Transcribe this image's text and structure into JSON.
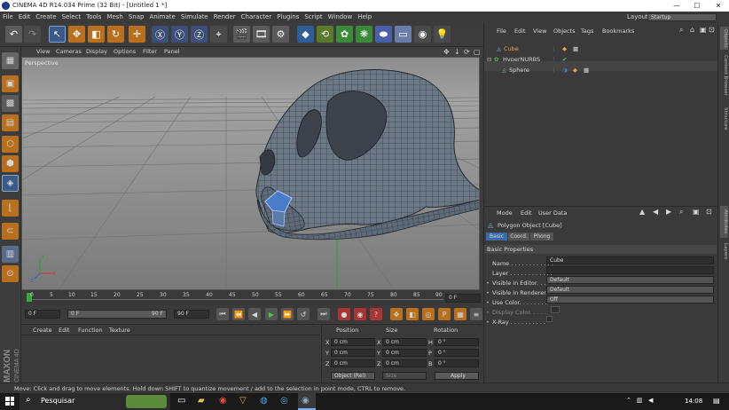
{
  "window": {
    "title": "CINEMA 4D R14.034 Prime (32 Bit) - [Untitled 1 *]",
    "min": "—",
    "max": "☐",
    "close": "✕"
  },
  "menu": [
    "File",
    "Edit",
    "Create",
    "Select",
    "Tools",
    "Mesh",
    "Snap",
    "Animate",
    "Simulate",
    "Render",
    "Character",
    "Plugins",
    "Script",
    "Window",
    "Help"
  ],
  "layout": {
    "label": "Layout:",
    "value": "Startup"
  },
  "viewport": {
    "menu": [
      "View",
      "Cameras",
      "Display",
      "Options",
      "Filter",
      "Panel"
    ],
    "label": "Perspective"
  },
  "timeline": {
    "ticks": [
      "0",
      "5",
      "10",
      "15",
      "20",
      "25",
      "30",
      "35",
      "40",
      "45",
      "50",
      "55",
      "60",
      "65",
      "70",
      "75",
      "80",
      "85",
      "90"
    ],
    "current": "0 F"
  },
  "controls": {
    "start": "0 F",
    "range_start": "0 F",
    "range_end": "90 F",
    "end": "90 F"
  },
  "material": {
    "menu": [
      "Create",
      "Edit",
      "Function",
      "Texture"
    ]
  },
  "coords": {
    "headers": [
      "Position",
      "Size",
      "Rotation"
    ],
    "rows": [
      {
        "axis": "X",
        "pos": "0 cm",
        "size_axis": "X",
        "size": "0 cm",
        "rot_axis": "H",
        "rot": "0 °"
      },
      {
        "axis": "Y",
        "pos": "0 cm",
        "size_axis": "Y",
        "size": "0 cm",
        "rot_axis": "P",
        "rot": "0 °"
      },
      {
        "axis": "Z",
        "pos": "0 cm",
        "size_axis": "Z",
        "size": "0 cm",
        "rot_axis": "B",
        "rot": "0 °"
      }
    ],
    "mode": "Object (Rel)",
    "size_mode": "Size",
    "apply": "Apply"
  },
  "objects": {
    "menu": [
      "File",
      "Edit",
      "View",
      "Objects",
      "Tags",
      "Bookmarks"
    ],
    "items": [
      {
        "name": "Cube",
        "color": "#e8a544"
      },
      {
        "name": "HyperNURBS",
        "color": "#d0d0d0"
      },
      {
        "name": "Sphere",
        "color": "#d0d0d0"
      }
    ]
  },
  "attributes": {
    "menu": [
      "Mode",
      "Edit",
      "User Data"
    ],
    "object_title": "Polygon Object [Cube]",
    "tabs": [
      "Basic",
      "Coord.",
      "Phong"
    ],
    "section": "Basic Properties",
    "props": [
      {
        "label": "Name . . . . . . . . . . . .",
        "value": "Cube"
      },
      {
        "label": "Layer . . . . . . . . . . . .",
        "value": ""
      },
      {
        "label": "Visible in Editor. . .",
        "value": "Default"
      },
      {
        "label": "Visible in Renderer",
        "value": "Default"
      },
      {
        "label": "Use Color. . . . . . . .",
        "value": "Off"
      },
      {
        "label": "Display Color. . . . .",
        "value": ""
      },
      {
        "label": "X-Ray . . . . . . . . . .",
        "value": ""
      }
    ]
  },
  "side_tabs": [
    "Objects",
    "Content Browser",
    "Structure"
  ],
  "side_tabs2": [
    "Attributes",
    "Layers"
  ],
  "status": "Move: Click and drag to move elements. Hold down SHIFT to quantize movement / add to the selection in point mode, CTRL to remove.",
  "taskbar": {
    "search": "Pesquisar",
    "time": "14:08"
  },
  "brand": {
    "line1": "MAXON",
    "line2": "CINEMA 4D"
  }
}
